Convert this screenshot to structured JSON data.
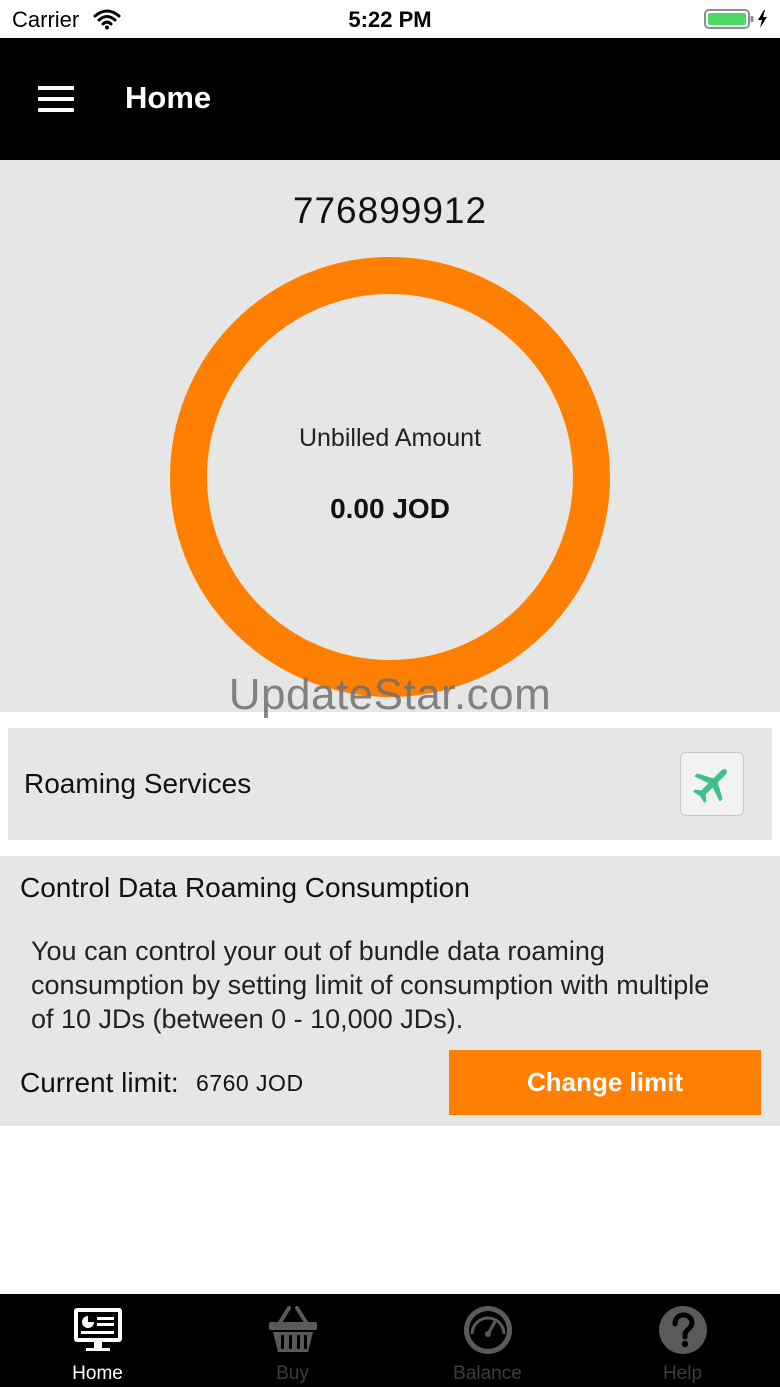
{
  "status_bar": {
    "carrier": "Carrier",
    "time": "5:22 PM"
  },
  "header": {
    "title": "Home",
    "menu_icon": "hamburger-menu-icon"
  },
  "account": {
    "phone_number": "776899912",
    "unbilled_label": "Unbilled Amount",
    "unbilled_value": "0.00 JOD",
    "ring_color": "#ff7f00"
  },
  "watermark": "UpdateStar.com",
  "roaming": {
    "label": "Roaming Services",
    "icon": "airplane-icon",
    "icon_color": "#3fbf8a"
  },
  "data_roaming": {
    "title": "Control Data Roaming Consumption",
    "description": "You can control your out of bundle data roaming consumption by setting limit of consumption with multiple of 10 JDs (between 0 - 10,000 JDs).",
    "current_limit_label": "Current limit:",
    "current_limit_value": "6760 JOD",
    "change_button": "Change limit"
  },
  "tabs": [
    {
      "label": "Home",
      "icon": "monitor-icon",
      "active": true
    },
    {
      "label": "Buy",
      "icon": "basket-icon",
      "active": false
    },
    {
      "label": "Balance",
      "icon": "gauge-icon",
      "active": false
    },
    {
      "label": "Help",
      "icon": "question-icon",
      "active": false
    }
  ],
  "colors": {
    "accent": "#ff7f00",
    "header_bg": "#000000",
    "panel_bg": "#e6e6e6"
  }
}
